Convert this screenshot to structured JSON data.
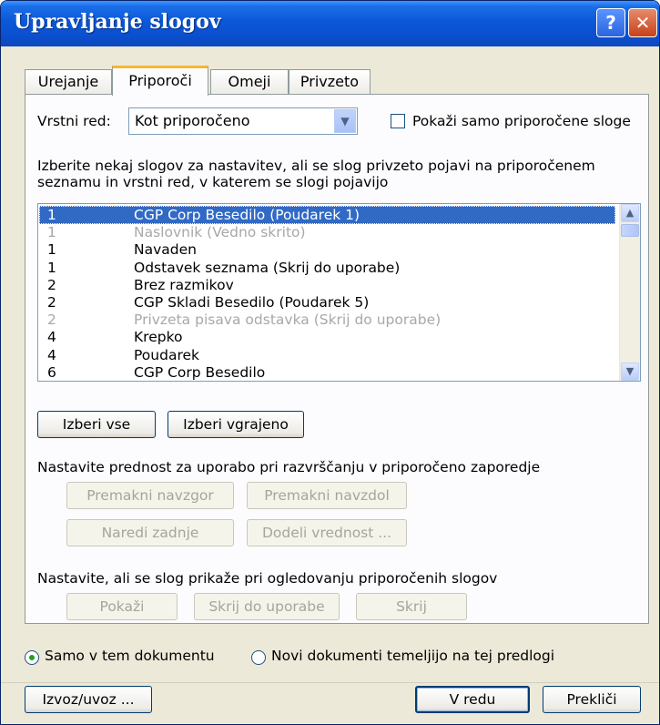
{
  "window": {
    "title": "Upravljanje slogov",
    "help_glyph": "?",
    "close_glyph": "✕"
  },
  "tabs": [
    {
      "label": "Urejanje"
    },
    {
      "label": "Priporoči"
    },
    {
      "label": "Omeji"
    },
    {
      "label": "Privzeto"
    }
  ],
  "active_tab": "Priporoči",
  "sort": {
    "label": "Vrstni red:",
    "value": "Kot priporočeno"
  },
  "show_recommended_only": {
    "label": "Pokaži samo priporočene sloge",
    "checked": false
  },
  "instruction": "Izberite nekaj slogov za nastavitev, ali se slog privzeto pojavi na priporočenem seznamu in vrstni red, v katerem se slogi pojavijo",
  "styles": [
    {
      "priority": "1",
      "name": "CGP Corp Besedilo (Poudarek 1)",
      "selected": true,
      "dimmed": false
    },
    {
      "priority": "1",
      "name": "Naslovnik  (Vedno skrito)",
      "selected": false,
      "dimmed": true
    },
    {
      "priority": "1",
      "name": "Navaden",
      "selected": false,
      "dimmed": false
    },
    {
      "priority": "1",
      "name": "Odstavek seznama  (Skrij do uporabe)",
      "selected": false,
      "dimmed": false
    },
    {
      "priority": "2",
      "name": "Brez razmikov",
      "selected": false,
      "dimmed": false
    },
    {
      "priority": "2",
      "name": "CGP Skladi Besedilo (Poudarek 5)",
      "selected": false,
      "dimmed": false
    },
    {
      "priority": "2",
      "name": "Privzeta pisava odstavka  (Skrij do uporabe)",
      "selected": false,
      "dimmed": true
    },
    {
      "priority": "4",
      "name": "Krepko",
      "selected": false,
      "dimmed": false
    },
    {
      "priority": "4",
      "name": "Poudarek",
      "selected": false,
      "dimmed": false
    },
    {
      "priority": "6",
      "name": "CGP Corp Besedilo",
      "selected": false,
      "dimmed": false
    }
  ],
  "select_buttons": {
    "select_all": "Izberi vse",
    "select_builtin": "Izberi vgrajeno"
  },
  "priority_section": {
    "label": "Nastavite prednost za uporabo pri razvrščanju v priporočeno zaporedje",
    "move_up": "Premakni navzgor",
    "move_down": "Premakni navzdol",
    "move_last": "Naredi zadnje",
    "assign_value": "Dodeli vrednost ..."
  },
  "visibility_section": {
    "label": "Nastavite, ali se slog prikaže pri ogledovanju priporočenih slogov",
    "show": "Pokaži",
    "hide_until_used": "Skrij do uporabe",
    "hide": "Skrij"
  },
  "scope": {
    "this_document": "Samo v tem dokumentu",
    "new_documents": "Novi dokumenti temeljijo na tej predlogi",
    "selected": "this_document"
  },
  "footer": {
    "import_export": "Izvoz/uvoz ...",
    "ok": "V redu",
    "cancel": "Prekliči"
  },
  "colors": {
    "title_bar": "#0a58d8",
    "selection": "#316ac5",
    "active_tab_accent": "#f6b634",
    "dialog_bg": "#ece9d8"
  }
}
